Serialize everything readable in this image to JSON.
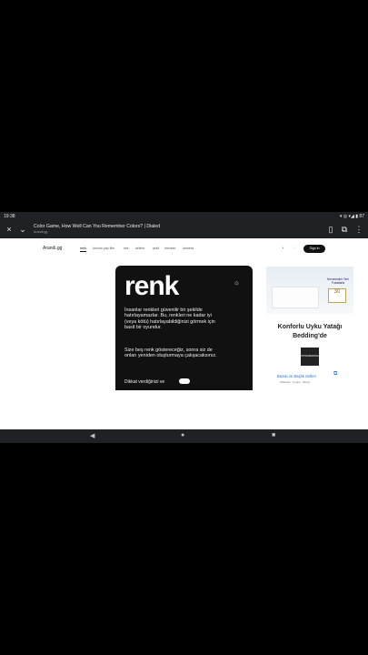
{
  "status_bar": {
    "time": "19:38",
    "right": "▾ ◎ ▾◢ ▮ 87"
  },
  "tab": {
    "close_icon": "×",
    "chevron_icon": "⌄",
    "title": "Color Game, How Well Can You Remember Colors? | Dialed",
    "url": "Arandi.gg",
    "bookmark_icon": "▯",
    "translate_icon": "⧉",
    "menu_icon": "⋮"
  },
  "site": {
    "logo": "Arandi.gg",
    "nav": [
      "renk",
      "konum yap film",
      "ses",
      "kelime",
      "şekil",
      "mevsim",
      "kamera"
    ],
    "signin": "Sign in"
  },
  "card": {
    "word": "renk",
    "p1": "İnsanlar renkleri güvenilir bir şekilde hatırlayamazlar. Bu, renkleri ne kadar iyi (veya kötü) hatırlayabildiğinizi görmek için basit bir oyundur.",
    "p2": "Size beş renk göstereceğiz, sonra siz de onları yeniden oluşturmaya çalışacaksınız.",
    "bottom": "Dikkat verdiğinizi ve"
  },
  "ad": {
    "tag": "Nevresimler Yeni Fırsatlarla",
    "badge": "30",
    "heading": "Konforlu Uyku Yatağı Bedding'de",
    "logo": "HOTELBEDDING",
    "link": "Bazalı ve Başlık Setleri",
    "sub": "Alfabetik · Uygun · Bütçe"
  },
  "android_nav": {
    "back": "◀",
    "home": "●",
    "recents": "■"
  }
}
